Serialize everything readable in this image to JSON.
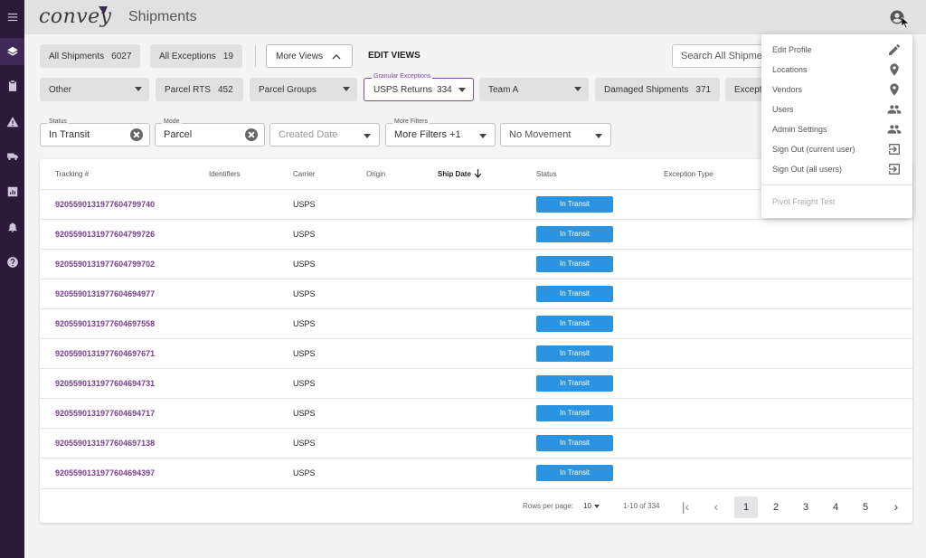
{
  "app": {
    "logo": "convey",
    "title": "Shipments"
  },
  "colors": {
    "rail": "#2b1a3a",
    "accent": "#7a4ea6",
    "link": "#7a3f8f",
    "status": "#2a94e2"
  },
  "rail": {
    "icons": [
      "menu-icon",
      "layers-icon",
      "clipboard-icon",
      "alert-icon",
      "truck-icon",
      "chart-icon",
      "bell-icon",
      "help-icon"
    ]
  },
  "views": {
    "all_shipments": {
      "label": "All Shipments",
      "count": "6027"
    },
    "all_exceptions": {
      "label": "All Exceptions",
      "count": "19"
    },
    "more_views": "More Views",
    "edit_views": "EDIT VIEWS",
    "search_placeholder": "Search All Shipments"
  },
  "chips": {
    "other": "Other",
    "parcel_rts": {
      "label": "Parcel RTS",
      "count": "452"
    },
    "parcel_groups": "Parcel Groups",
    "granular": {
      "legend": "Granular Exceptions",
      "label": "USPS Returns",
      "count": "334"
    },
    "team": "Team A",
    "damaged": {
      "label": "Damaged Shipments",
      "count": "371"
    },
    "exceptions_cut": "Exceptio"
  },
  "filters": {
    "status": {
      "label": "Status",
      "value": "In Transit"
    },
    "mode": {
      "label": "Mode",
      "value": "Parcel"
    },
    "created_date": "Created Date",
    "more": {
      "label": "More Filters",
      "value": "More Filters +1"
    },
    "movement": "No Movement"
  },
  "table": {
    "headers": {
      "tracking": "Tracking #",
      "identifiers": "Identifiers",
      "carrier": "Carrier",
      "origin": "Origin",
      "ship_date": "Ship Date",
      "status": "Status",
      "exception_type": "Exception Type"
    },
    "rows": [
      {
        "tracking": "9205590131977604799740",
        "carrier": "USPS",
        "status": "In Transit"
      },
      {
        "tracking": "9205590131977604799726",
        "carrier": "USPS",
        "status": "In Transit"
      },
      {
        "tracking": "9205590131977604799702",
        "carrier": "USPS",
        "status": "In Transit"
      },
      {
        "tracking": "9205590131977604694977",
        "carrier": "USPS",
        "status": "In Transit"
      },
      {
        "tracking": "9205590131977604697558",
        "carrier": "USPS",
        "status": "In Transit"
      },
      {
        "tracking": "9205590131977604697671",
        "carrier": "USPS",
        "status": "In Transit"
      },
      {
        "tracking": "9205590131977604694731",
        "carrier": "USPS",
        "status": "In Transit"
      },
      {
        "tracking": "9205590131977604694717",
        "carrier": "USPS",
        "status": "In Transit"
      },
      {
        "tracking": "9205590131977604697138",
        "carrier": "USPS",
        "status": "In Transit"
      },
      {
        "tracking": "9205590131977604694397",
        "carrier": "USPS",
        "status": "In Transit"
      }
    ]
  },
  "pagination": {
    "rows_label": "Rows per page:",
    "rows_value": "10",
    "range": "1-10 of 334",
    "pages": [
      "1",
      "2",
      "3",
      "4",
      "5"
    ],
    "current": "1"
  },
  "menu": {
    "items": [
      {
        "label": "Edit Profile",
        "icon": "pencil-icon"
      },
      {
        "label": "Locations",
        "icon": "location-pin-icon"
      },
      {
        "label": "Vendors",
        "icon": "location-pin-icon"
      },
      {
        "label": "Users",
        "icon": "people-icon"
      },
      {
        "label": "Admin Settings",
        "icon": "people-icon"
      },
      {
        "label": "Sign Out (current user)",
        "icon": "exit-icon"
      },
      {
        "label": "Sign Out (all users)",
        "icon": "exit-icon"
      }
    ],
    "footer": "Pivot Freight Test"
  }
}
